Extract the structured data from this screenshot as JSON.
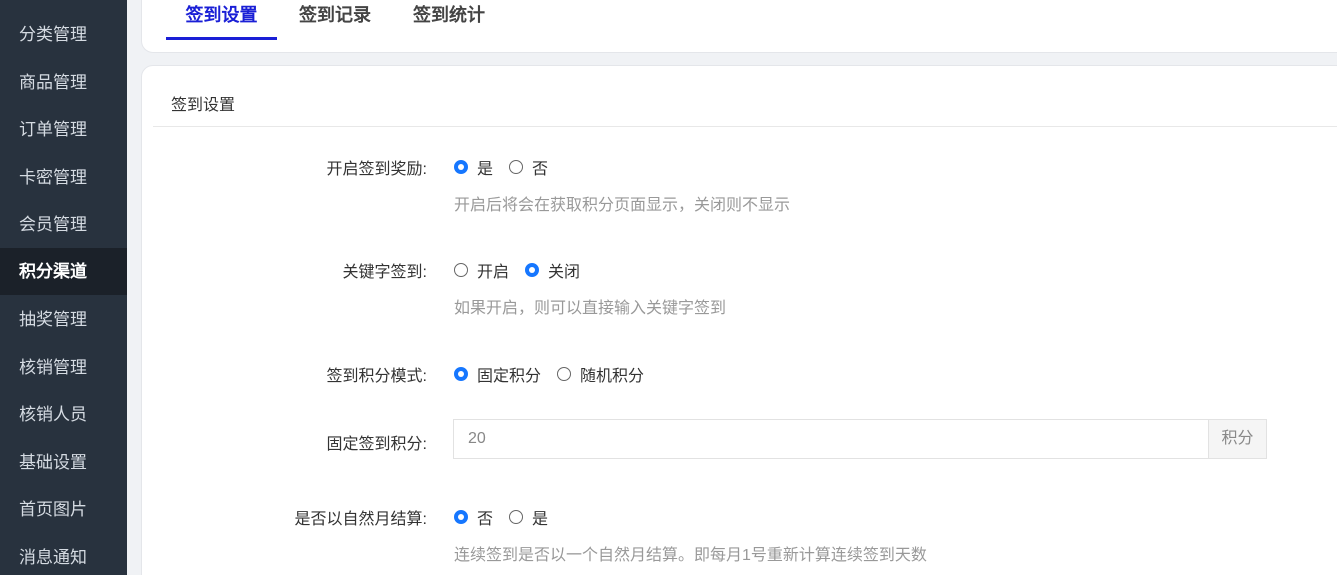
{
  "sidebar": {
    "items": [
      {
        "label": "分类管理"
      },
      {
        "label": "商品管理"
      },
      {
        "label": "订单管理"
      },
      {
        "label": "卡密管理"
      },
      {
        "label": "会员管理"
      },
      {
        "label": "积分渠道"
      },
      {
        "label": "抽奖管理"
      },
      {
        "label": "核销管理"
      },
      {
        "label": "核销人员"
      },
      {
        "label": "基础设置"
      },
      {
        "label": "首页图片"
      },
      {
        "label": "消息通知"
      }
    ],
    "active": "积分渠道"
  },
  "tabs": [
    {
      "label": "签到设置"
    },
    {
      "label": "签到记录"
    },
    {
      "label": "签到统计"
    }
  ],
  "card": {
    "title": "签到设置"
  },
  "form": {
    "sign_reward": {
      "label": "开启签到奖励:",
      "options": [
        "是",
        "否"
      ],
      "selected": "是",
      "help": "开启后将会在获取积分页面显示，关闭则不显示"
    },
    "keyword_sign": {
      "label": "关键字签到:",
      "options": [
        "开启",
        "关闭"
      ],
      "selected": "关闭",
      "help": "如果开启，则可以直接输入关键字签到"
    },
    "points_mode": {
      "label": "签到积分模式:",
      "options": [
        "固定积分",
        "随机积分"
      ],
      "selected": "固定积分"
    },
    "fixed_points": {
      "label": "固定签到积分:",
      "value": "20",
      "suffix": "积分"
    },
    "natural_month": {
      "label": "是否以自然月结算:",
      "options": [
        "否",
        "是"
      ],
      "selected": "否",
      "help": "连续签到是否以一个自然月结算。即每月1号重新计算连续签到天数"
    }
  },
  "colors": {
    "sidebar_bg": "#28323e",
    "sidebar_active_bg": "#1b2129",
    "tab_active": "#1a1fd6",
    "radio_checked": "#1677ff"
  }
}
